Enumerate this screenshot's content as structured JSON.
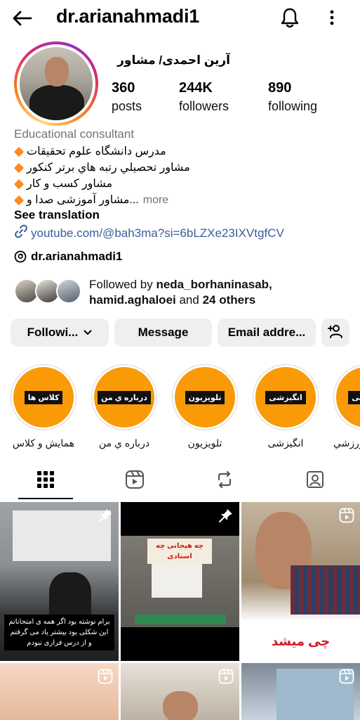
{
  "header": {
    "username": "dr.arianahmadi1"
  },
  "profile": {
    "full_name": "آرین احمدی/ مشاور",
    "stats": [
      {
        "value": "360",
        "label": "posts"
      },
      {
        "value": "244K",
        "label": "followers"
      },
      {
        "value": "890",
        "label": "following"
      }
    ],
    "category": "Educational consultant",
    "bio_lines": [
      "مدرس دانشگاه علوم تحقیقات",
      "مشاور تحصیلي رتبه هاي برتر کنکور",
      "مشاور کسب و کار",
      "...مشاور آموزشی صدا و"
    ],
    "more_label": "more",
    "see_translation": "See translation",
    "link": "youtube.com/@bah3ma?si=6bLZXe23IXVtgfCV",
    "threads_handle": "dr.arianahmadi1",
    "followed_by_prefix": "Followed by ",
    "followed_by_user1": "neda_borhaninasab,",
    "followed_by_user2": "hamid.aghaloei",
    "followed_by_and": " and ",
    "followed_by_others": "24 others"
  },
  "actions": {
    "following_label": "Followi...",
    "message_label": "Message",
    "email_label": "Email addre..."
  },
  "highlights": [
    {
      "tag": "کلاس ها",
      "label": "همایش و کلاس"
    },
    {
      "tag": "درباره ي من",
      "label": "درباره ي من"
    },
    {
      "tag": "تلویزیون",
      "label": "تلویزیون"
    },
    {
      "tag": "انگیزشی",
      "label": "انگیزشی"
    },
    {
      "tag": "ورزشی",
      "label": "ورزشي"
    }
  ],
  "posts": {
    "post1_caption": "برام نوشته بود اگر همه ی امتحاناتم این شکلی بود بیشتر یاد می گرفتم و از درس فراری نبودم",
    "post2_caption": "چه هیجانی چه استادی",
    "post3_caption": "چی میشد"
  },
  "colors": {
    "link": "#3c5c9a",
    "highlight": "#fa9a07",
    "bio_bullet": "#ff8a1e",
    "button_bg": "#efefef",
    "muted": "#737373"
  },
  "icons": {
    "back": "arrow-left",
    "bell": "bell",
    "menu": "kebab-vertical",
    "add_person": "person-plus",
    "grid": "grid-tab",
    "reels": "reels-tab",
    "reposts": "repost-tab",
    "tagged": "tagged-tab"
  }
}
